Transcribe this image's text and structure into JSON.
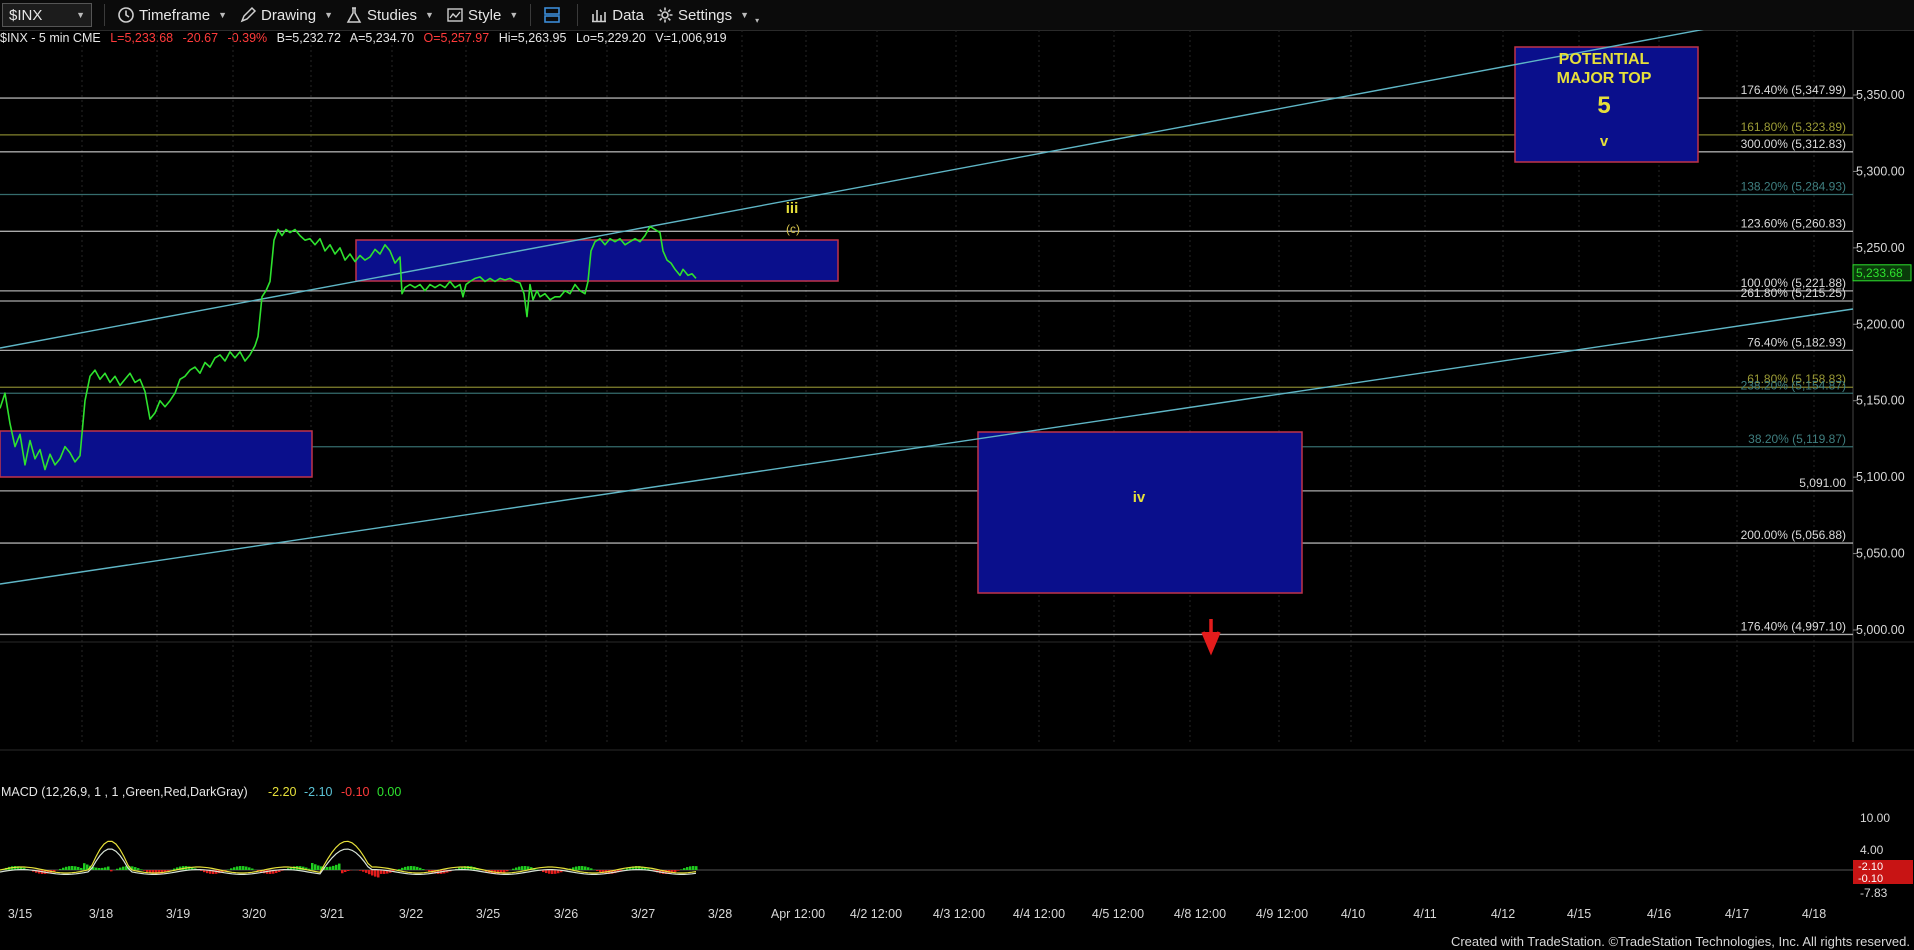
{
  "toolbar": {
    "symbol": "$INX",
    "items": [
      {
        "label": "Timeframe",
        "icon": "clock-icon"
      },
      {
        "label": "Drawing",
        "icon": "pencil-icon"
      },
      {
        "label": "Studies",
        "icon": "flask-icon"
      },
      {
        "label": "Style",
        "icon": "chart-style-icon"
      },
      {
        "label": "",
        "icon": "layout-icon"
      },
      {
        "label": "Data",
        "icon": "bar-chart-icon"
      },
      {
        "label": "Settings",
        "icon": "gear-icon"
      }
    ]
  },
  "info": {
    "symbol_desc": "$INX - 5 min  CME",
    "last": "L=5,233.68",
    "change": "-20.67",
    "pct": "-0.39%",
    "bid": "B=5,232.72",
    "ask": "A=5,234.70",
    "open": "O=5,257.97",
    "high": "Hi=5,263.95",
    "low": "Lo=5,229.20",
    "volume": "V=1,006,919"
  },
  "macd": {
    "label": "MACD (12,26,9, 1 , 1 ,Green,Red,DarkGray)",
    "v1": "-2.20",
    "v2": "-2.10",
    "v3": "-0.10",
    "v4": "0.00",
    "axis_ticks": [
      "10.00",
      "4.00",
      "-7.83"
    ],
    "last_tag": "-2.10",
    "last_tag2": "-0.10"
  },
  "footer": "Created with TradeStation. ©TradeStation Technologies, Inc. All rights reserved.",
  "chart_data": {
    "type": "line",
    "title": "",
    "ylim": [
      4990,
      5380
    ],
    "y_ticks": [
      "5,350.00",
      "5,300.00",
      "5,250.00",
      "5,200.00",
      "5,150.00",
      "5,100.00",
      "5,050.00",
      "5,000.00"
    ],
    "x_ticks": [
      "3/15",
      "3/18",
      "3/19",
      "3/20",
      "3/21",
      "3/22",
      "3/25",
      "3/26",
      "3/27",
      "3/28",
      "Apr 12:00",
      "4/2 12:00",
      "4/3 12:00",
      "4/4 12:00",
      "4/5 12:00",
      "4/8 12:00",
      "4/9 12:00",
      "4/10",
      "4/11",
      "4/12",
      "4/15",
      "4/16",
      "4/17",
      "4/18"
    ],
    "last_price_tag": "5,233.68",
    "price_series": [
      [
        0,
        5145
      ],
      [
        5,
        5155
      ],
      [
        10,
        5135
      ],
      [
        15,
        5120
      ],
      [
        20,
        5128
      ],
      [
        25,
        5108
      ],
      [
        30,
        5124
      ],
      [
        35,
        5112
      ],
      [
        40,
        5118
      ],
      [
        45,
        5105
      ],
      [
        50,
        5115
      ],
      [
        55,
        5108
      ],
      [
        60,
        5112
      ],
      [
        65,
        5120
      ],
      [
        70,
        5116
      ],
      [
        75,
        5110
      ],
      [
        80,
        5114
      ],
      [
        85,
        5150
      ],
      [
        90,
        5166
      ],
      [
        95,
        5170
      ],
      [
        100,
        5164
      ],
      [
        105,
        5168
      ],
      [
        110,
        5162
      ],
      [
        115,
        5166
      ],
      [
        120,
        5160
      ],
      [
        125,
        5164
      ],
      [
        130,
        5168
      ],
      [
        135,
        5162
      ],
      [
        140,
        5164
      ],
      [
        145,
        5156
      ],
      [
        150,
        5138
      ],
      [
        155,
        5142
      ],
      [
        160,
        5150
      ],
      [
        165,
        5146
      ],
      [
        170,
        5150
      ],
      [
        175,
        5155
      ],
      [
        180,
        5164
      ],
      [
        185,
        5166
      ],
      [
        190,
        5170
      ],
      [
        195,
        5172
      ],
      [
        200,
        5168
      ],
      [
        205,
        5175
      ],
      [
        210,
        5172
      ],
      [
        215,
        5178
      ],
      [
        220,
        5180
      ],
      [
        225,
        5176
      ],
      [
        230,
        5182
      ],
      [
        235,
        5178
      ],
      [
        240,
        5182
      ],
      [
        245,
        5176
      ],
      [
        250,
        5180
      ],
      [
        255,
        5186
      ],
      [
        258,
        5192
      ],
      [
        262,
        5218
      ],
      [
        266,
        5222
      ],
      [
        270,
        5228
      ],
      [
        274,
        5255
      ],
      [
        278,
        5262
      ],
      [
        282,
        5258
      ],
      [
        286,
        5262
      ],
      [
        290,
        5260
      ],
      [
        295,
        5262
      ],
      [
        300,
        5258
      ],
      [
        305,
        5255
      ],
      [
        310,
        5256
      ],
      [
        315,
        5252
      ],
      [
        320,
        5256
      ],
      [
        325,
        5248
      ],
      [
        330,
        5252
      ],
      [
        335,
        5246
      ],
      [
        340,
        5250
      ],
      [
        345,
        5242
      ],
      [
        350,
        5246
      ],
      [
        355,
        5241
      ],
      [
        360,
        5245
      ],
      [
        365,
        5242
      ],
      [
        370,
        5244
      ],
      [
        375,
        5249
      ],
      [
        380,
        5246
      ],
      [
        385,
        5252
      ],
      [
        390,
        5248
      ],
      [
        395,
        5240
      ],
      [
        400,
        5244
      ],
      [
        402,
        5220
      ],
      [
        405,
        5224
      ],
      [
        410,
        5226
      ],
      [
        415,
        5224
      ],
      [
        420,
        5226
      ],
      [
        425,
        5222
      ],
      [
        430,
        5226
      ],
      [
        435,
        5224
      ],
      [
        440,
        5226
      ],
      [
        445,
        5224
      ],
      [
        450,
        5228
      ],
      [
        455,
        5224
      ],
      [
        460,
        5226
      ],
      [
        463,
        5218
      ],
      [
        466,
        5226
      ],
      [
        470,
        5228
      ],
      [
        475,
        5230
      ],
      [
        480,
        5231
      ],
      [
        485,
        5228
      ],
      [
        490,
        5230
      ],
      [
        495,
        5228
      ],
      [
        500,
        5230
      ],
      [
        505,
        5229
      ],
      [
        510,
        5230
      ],
      [
        515,
        5228
      ],
      [
        520,
        5227
      ],
      [
        524,
        5220
      ],
      [
        527,
        5205
      ],
      [
        530,
        5226
      ],
      [
        533,
        5216
      ],
      [
        537,
        5222
      ],
      [
        540,
        5218
      ],
      [
        545,
        5220
      ],
      [
        550,
        5216
      ],
      [
        555,
        5218
      ],
      [
        560,
        5218
      ],
      [
        565,
        5222
      ],
      [
        570,
        5220
      ],
      [
        575,
        5226
      ],
      [
        580,
        5222
      ],
      [
        585,
        5220
      ],
      [
        588,
        5228
      ],
      [
        591,
        5248
      ],
      [
        595,
        5254
      ],
      [
        600,
        5256
      ],
      [
        605,
        5252
      ],
      [
        610,
        5256
      ],
      [
        615,
        5254
      ],
      [
        620,
        5256
      ],
      [
        625,
        5252
      ],
      [
        630,
        5254
      ],
      [
        635,
        5256
      ],
      [
        640,
        5254
      ],
      [
        645,
        5258
      ],
      [
        650,
        5264
      ],
      [
        655,
        5262
      ],
      [
        660,
        5260
      ],
      [
        663,
        5248
      ],
      [
        667,
        5242
      ],
      [
        671,
        5240
      ],
      [
        675,
        5236
      ],
      [
        680,
        5232
      ],
      [
        683,
        5236
      ],
      [
        688,
        5232
      ],
      [
        692,
        5233
      ],
      [
        696,
        5230
      ]
    ],
    "fib_levels": [
      {
        "label": "176.40% (5,347.99)",
        "value": 5347.99,
        "color": "#c8c8c8"
      },
      {
        "label": "161.80% (5,323.89)",
        "value": 5323.89,
        "color": "#9b9b36"
      },
      {
        "label": "300.00% (5,312.83)",
        "value": 5312.83,
        "color": "#c8c8c8"
      },
      {
        "label": "138.20% (5,284.93)",
        "value": 5284.93,
        "color": "#3f7f80"
      },
      {
        "label": "123.60% (5,260.83)",
        "value": 5260.83,
        "color": "#c8c8c8"
      },
      {
        "label": "100.00% (5,221.88)",
        "value": 5221.88,
        "color": "#c8c8c8"
      },
      {
        "label": "261.80% (5,215.25)",
        "value": 5215.25,
        "color": "#c8c8c8"
      },
      {
        "label": "76.40% (5,182.93)",
        "value": 5182.93,
        "color": "#c8c8c8"
      },
      {
        "label": "61.80% (5,158.83)",
        "value": 5158.83,
        "color": "#9b9b36"
      },
      {
        "label": "238.20% (5,154.87)",
        "value": 5154.87,
        "color": "#3f7f80"
      },
      {
        "label": "38.20% (5,119.87)",
        "value": 5119.87,
        "color": "#3f7f80"
      },
      {
        "label": "5,091.00",
        "value": 5091.0,
        "color": "#c8c8c8"
      },
      {
        "label": "200.00% (5,056.88)",
        "value": 5056.88,
        "color": "#c8c8c8"
      },
      {
        "label": "176.40% (4,997.10)",
        "value": 4997.1,
        "color": "#c8c8c8"
      }
    ],
    "annotations": {
      "wave_iii": "iii",
      "wave_c": "(c)",
      "wave_iv": "iv",
      "top_line1": "POTENTIAL",
      "top_line2": "MAJOR TOP",
      "top_5": "5",
      "top_v": "v"
    }
  }
}
